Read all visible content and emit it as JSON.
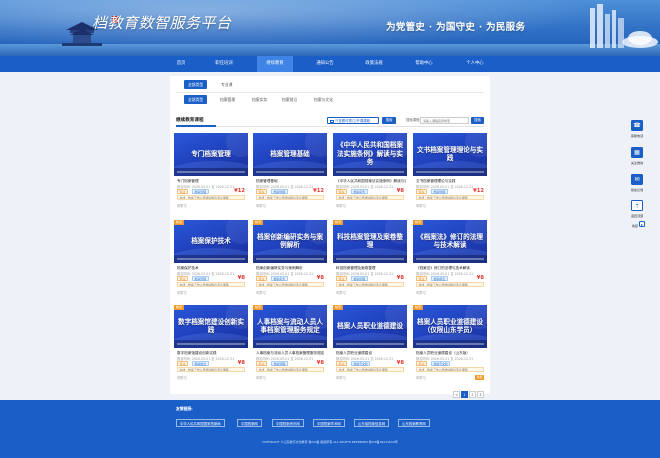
{
  "header": {
    "logo_seal": "档",
    "site_title": "教育数智服务平台",
    "slogan": "为党管史 · 为国守史 · 为民服务"
  },
  "nav": {
    "items": [
      "首页",
      "职任培训",
      "继续教育",
      "通知公告",
      "政策法规",
      "帮助中心",
      "个人中心"
    ],
    "active_index": 2
  },
  "filters": {
    "row1": [
      {
        "label": "全部类型",
        "active": true
      },
      {
        "label": "专业课",
        "active": false
      }
    ],
    "row2": [
      {
        "label": "全部类型",
        "active": true
      },
      {
        "label": "档案管理",
        "active": false
      },
      {
        "label": "档案实务",
        "active": false
      },
      {
        "label": "档案前沿",
        "active": false
      },
      {
        "label": "档案与文化",
        "active": false
      }
    ]
  },
  "list": {
    "section_title": "继续教育课程",
    "checkbox_label": "只查看可预订/开课课程",
    "tool_button": "搜索",
    "search_label": "搜索课程",
    "search_placeholder": "请输入课程名称搜索",
    "search_button": "搜索"
  },
  "courses": [
    {
      "cover_tag": "",
      "cover_title": "专门档案管理",
      "title": "专门档案管理",
      "date": "报名时间: 2026-05-01 至 2026-12-31",
      "tag1": "专业",
      "tag2": "档案管理",
      "note": "在线 · 档案工作人员继续教育专业课程",
      "price": "¥12",
      "study": "可学习",
      "badge": ""
    },
    {
      "cover_tag": "",
      "cover_title": "档案管理基础",
      "title": "档案管理基础",
      "date": "报名时间: 2026-05-01 至 2026-12-31",
      "tag1": "专业",
      "tag2": "档案管理",
      "note": "在线 · 档案工作人员继续教育专业课程",
      "price": "¥12",
      "study": "可学习",
      "badge": ""
    },
    {
      "cover_tag": "",
      "cover_title": "《中华人民共和国档案法实施条例》解读与实务",
      "title": "《中华人民共和国档案法实施条例》解读与实务",
      "date": "报名时间: 2026-05-01 至 2026-12-31",
      "tag1": "专业",
      "tag2": "档案实务",
      "note": "在线 · 档案工作人员继续教育专业课程",
      "price": "¥8",
      "study": "可学习",
      "badge": ""
    },
    {
      "cover_tag": "",
      "cover_title": "文书档案管理理论与实践",
      "title": "文书档案管理理论与实践",
      "date": "报名时间: 2026-05-01 至 2026-12-31",
      "tag1": "专业",
      "tag2": "档案管理",
      "note": "在线 · 档案工作人员继续教育专业课程",
      "price": "¥12",
      "study": "可学习",
      "badge": ""
    },
    {
      "cover_tag": "精选",
      "cover_title": "档案保护技术",
      "title": "档案保护技术",
      "date": "报名时间: 2026-05-01 至 2026-12-31",
      "tag1": "专业",
      "tag2": "档案管理",
      "note": "在线 · 档案工作人员继续教育专业课程",
      "price": "¥8",
      "study": "可学习",
      "badge": ""
    },
    {
      "cover_tag": "精选",
      "cover_title": "档案创新编研实务与案例解析",
      "title": "档案创新编研实务与案例解析",
      "date": "报名时间: 2026-05-01 至 2026-12-31",
      "tag1": "专业",
      "tag2": "档案实务",
      "note": "在线 · 档案工作人员继续教育专业课程",
      "price": "¥8",
      "study": "可学习",
      "badge": ""
    },
    {
      "cover_tag": "精选",
      "cover_title": "科技档案管理及案卷整理",
      "title": "科技档案管理及案卷整理",
      "date": "报名时间: 2026-05-01 至 2026-12-31",
      "tag1": "专业",
      "tag2": "档案管理",
      "note": "在线 · 档案工作人员继续教育专业课程",
      "price": "¥8",
      "study": "可学习",
      "badge": ""
    },
    {
      "cover_tag": "精选",
      "cover_title": "《档案法》修订的法理与技术解读",
      "title": "《档案法》修订的法理与技术解读",
      "date": "报名时间: 2026-05-01 至 2026-12-31",
      "tag1": "专业",
      "tag2": "档案前沿",
      "note": "在线 · 档案工作人员继续教育专业课程",
      "price": "¥8",
      "study": "可学习",
      "badge": ""
    },
    {
      "cover_tag": "精选",
      "cover_title": "数字档案馆建设创新实践",
      "title": "数字档案馆建设创新实践",
      "date": "报名时间: 2026-05-01 至 2026-12-31",
      "tag1": "专业",
      "tag2": "档案前沿",
      "note": "在线 · 档案工作人员继续教育专业课程",
      "price": "¥8",
      "study": "可学习",
      "badge": ""
    },
    {
      "cover_tag": "精选",
      "cover_title": "人事档案与流动人员人事档案管理服务规定",
      "title": "人事档案与流动人员人事档案管理服务规定",
      "date": "报名时间: 2026-05-01 至 2026-12-31",
      "tag1": "专业",
      "tag2": "档案管理",
      "note": "在线 · 档案工作人员继续教育专业课程",
      "price": "¥8",
      "study": "可学习",
      "badge": ""
    },
    {
      "cover_tag": "精选",
      "cover_title": "档案人员职业道德建设",
      "title": "档案人员职业道德建设",
      "date": "报名时间: 2026-05-01 至 2026-12-31",
      "tag1": "专业",
      "tag2": "档案与文化",
      "note": "在线 · 档案工作人员继续教育专业课程",
      "price": "¥8",
      "study": "可学习",
      "badge": ""
    },
    {
      "cover_tag": "精选",
      "cover_title": "档案人员职业道德建设（仅限山东学员）",
      "title": "档案人员职业道德建设（山东版）",
      "date": "报名时间: 2026-05-01 至 2026-12-31",
      "tag1": "专业",
      "tag2": "档案与文化",
      "note": "在线 · 档案工作人员继续教育专业课程",
      "price": "",
      "study": "可学习",
      "badge": "免费"
    }
  ],
  "pagination": {
    "prev": "<",
    "pages": [
      "1",
      "2",
      "3"
    ],
    "active_index": 0,
    "next": ">"
  },
  "float_bar": {
    "items": [
      {
        "icon": "phone-icon",
        "glyph": "☎",
        "label": "客服电话"
      },
      {
        "icon": "qrcode-icon",
        "glyph": "▦",
        "label": "关注微信"
      },
      {
        "icon": "chat-icon",
        "glyph": "✉",
        "label": "留言反馈"
      },
      {
        "icon": "top-icon",
        "glyph": "⇡",
        "label": "返回顶部"
      },
      {
        "icon": "collapse-icon",
        "glyph": "▸",
        "label": "收起"
      }
    ]
  },
  "footer": {
    "links_title": "友情链接:",
    "links": [
      "中华人民共和国国家档案局",
      "中国档案网",
      "中国档案资讯网",
      "中国档案学术网",
      "山东省档案信息网",
      "山东档案教育网"
    ],
    "copyright": "COPYRIGHT ©山东数字文化教育 鲁ICP备 版权所有 ALL RIGHTS RESERVED 鲁ICP备16011610号"
  },
  "colors": {
    "brand": "#1a5fc7",
    "accent": "#f39a2a",
    "price": "#e53935"
  }
}
